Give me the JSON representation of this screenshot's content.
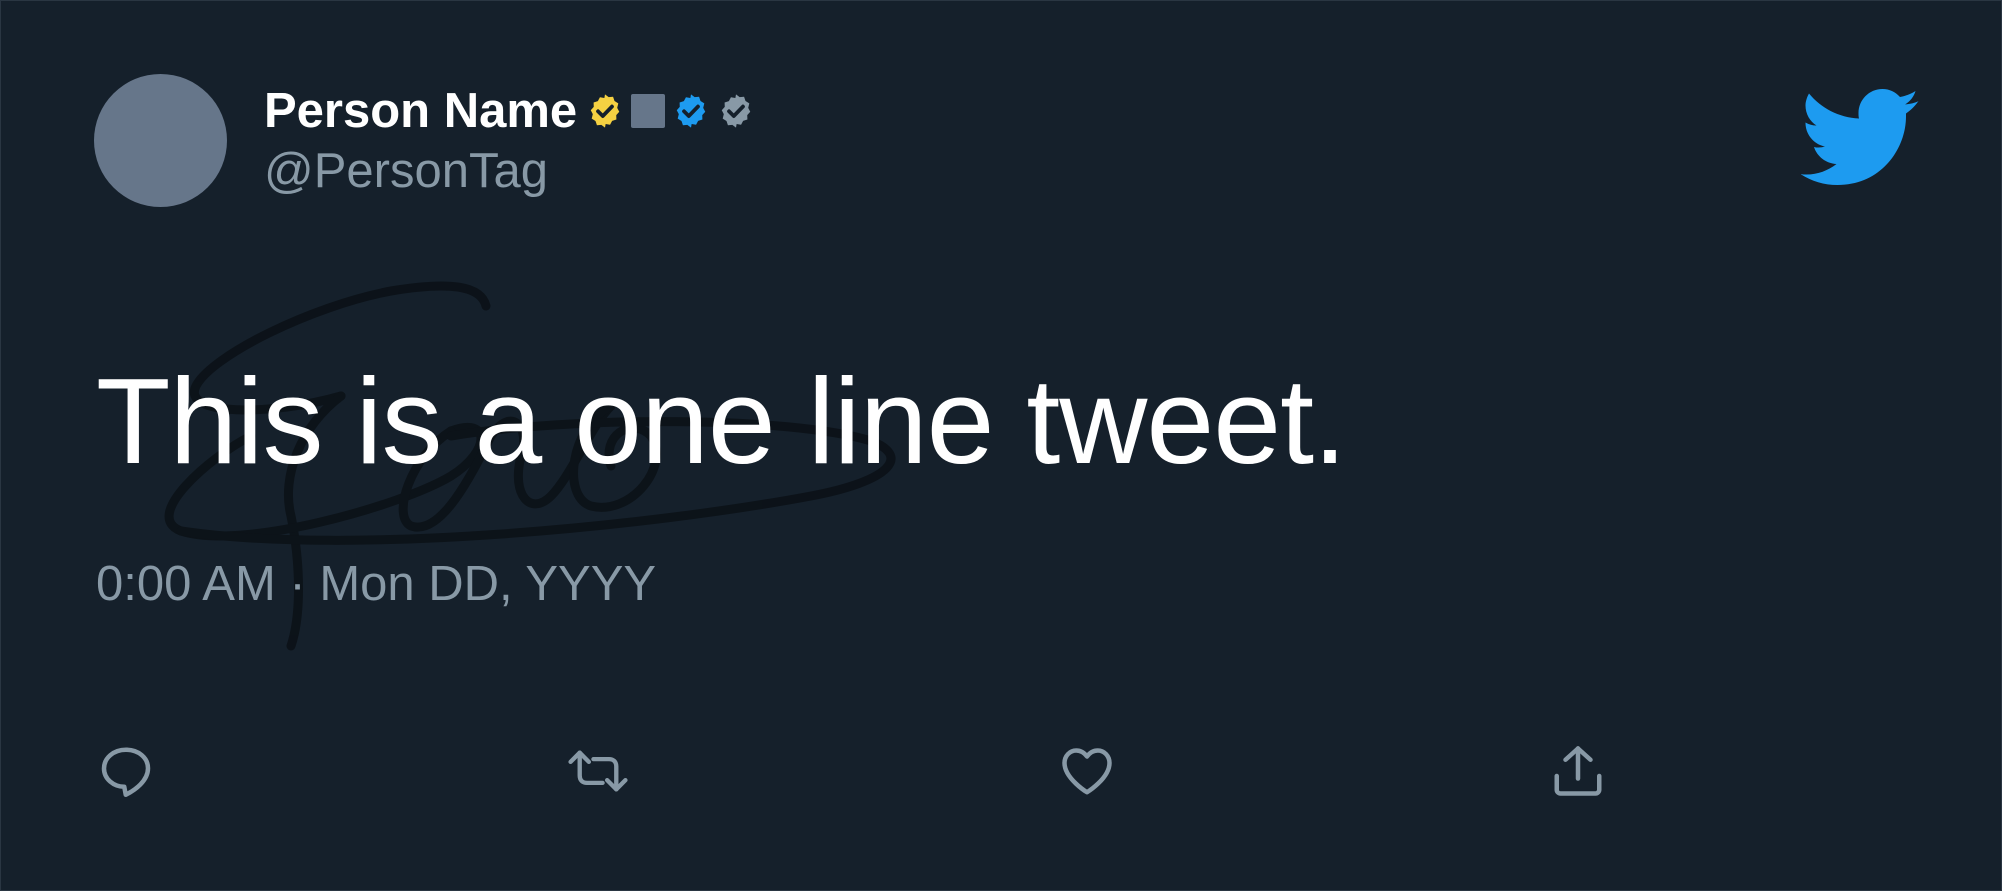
{
  "user": {
    "display_name": "Person Name",
    "handle": "@PersonTag",
    "avatar_color": "#66768a"
  },
  "badges": [
    {
      "icon": "gold-verified-badge-icon",
      "color": "#f5d142"
    },
    {
      "icon": "square-affiliation-badge-icon",
      "color": "#66768a"
    },
    {
      "icon": "blue-verified-badge-icon",
      "color": "#1d9bf0"
    },
    {
      "icon": "gray-verified-badge-icon",
      "color": "#8899a6"
    }
  ],
  "tweet": {
    "text": "This is a one line tweet.",
    "timestamp": "0:00 AM · Mon DD, YYYY"
  },
  "actions": [
    {
      "icon": "reply-icon"
    },
    {
      "icon": "retweet-icon"
    },
    {
      "icon": "like-icon"
    },
    {
      "icon": "share-icon"
    }
  ],
  "colors": {
    "background": "#15202b",
    "text_primary": "#ffffff",
    "text_secondary": "#8899a6",
    "brand": "#1d9bf0"
  },
  "brand_icon": "twitter-bird-icon",
  "watermark": "signature-watermark"
}
